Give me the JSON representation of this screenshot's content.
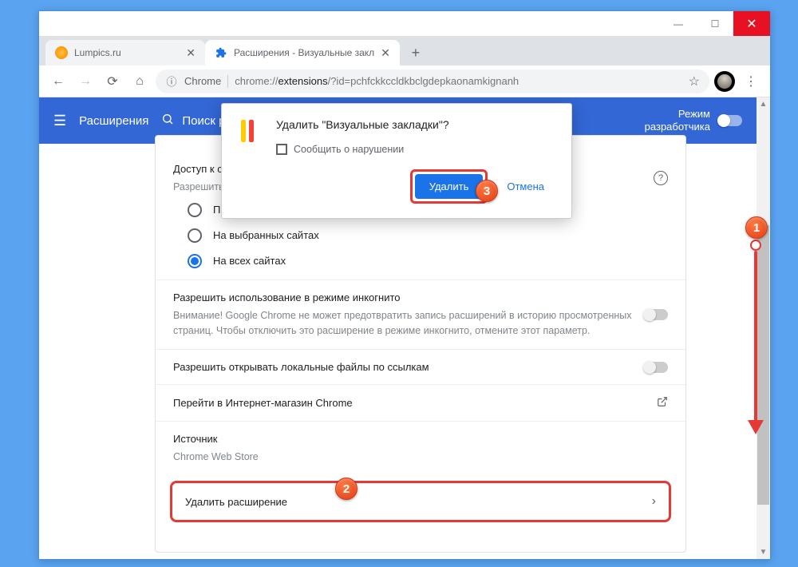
{
  "tabs": [
    {
      "label": "Lumpics.ru"
    },
    {
      "label": "Расширения - Визуальные закл"
    }
  ],
  "newtab_label": "+",
  "addressbar": {
    "scheme_label": "Chrome",
    "url_before": "chrome://",
    "url_bold": "extensions",
    "url_after": "/?id=pchfckkccldkbclgdepkaonamkignanh"
  },
  "header": {
    "title": "Расширения",
    "search_placeholder": "Поиск р",
    "dev_mode_line1": "Режим",
    "dev_mode_line2": "разработчика"
  },
  "card": {
    "access_title": "Доступ к са",
    "access_sub": "Разрешить",
    "radios": [
      {
        "label": "При нажатии",
        "checked": false
      },
      {
        "label": "На выбранных сайтах",
        "checked": false
      },
      {
        "label": "На всех сайтах",
        "checked": true
      }
    ],
    "incognito_title": "Разрешить использование в режиме инкогнито",
    "incognito_desc": "Внимание! Google Chrome не может предотвратить запись расширений в историю просмотренных страниц. Чтобы отключить это расширение в режиме инкогнито, отмените этот параметр.",
    "fileurls_title": "Разрешить открывать локальные файлы по ссылкам",
    "store_link": "Перейти в Интернет-магазин Chrome",
    "source_label": "Источник",
    "source_value": "Chrome Web Store",
    "remove_label": "Удалить расширение"
  },
  "dialog": {
    "title": "Удалить \"Визуальные закладки\"?",
    "report_label": "Сообщить о нарушении",
    "confirm_label": "Удалить",
    "cancel_label": "Отмена"
  },
  "markers": {
    "m1": "1",
    "m2": "2",
    "m3": "3"
  }
}
